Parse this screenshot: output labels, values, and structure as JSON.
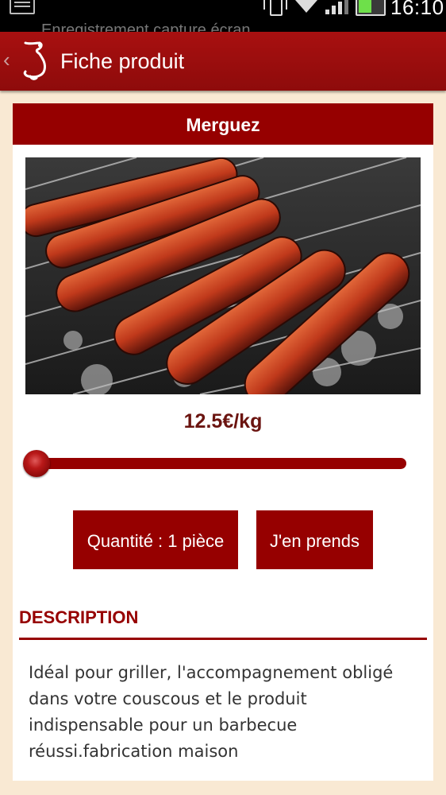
{
  "status_bar": {
    "time": "16:10",
    "notification_text": "Enregistrement capture écran",
    "icons": [
      "notification-icon",
      "vibrate-icon",
      "wifi-icon",
      "signal-icon",
      "battery-icon"
    ],
    "battery_color": "#6ee04a"
  },
  "action_bar": {
    "back_icon": "chevron-left-icon",
    "title": "Fiche produit",
    "background": "#a81010"
  },
  "product": {
    "name": "Merguez",
    "price": "12.5€/kg",
    "image": "merguez sausages on grill",
    "quantity_slider_level": 0
  },
  "buttons": {
    "quantity": "Quantité : 1 pièce",
    "take": "J'en prends"
  },
  "description": {
    "title": "DESCRIPTION",
    "text": "Idéal pour griller, l'accompagnement obligé dans votre couscous et le produit indispensable pour un barbecue réussi.fabrication maison"
  },
  "colors": {
    "primary": "#960000",
    "background": "#f9e9d3",
    "price_text": "#6b1410"
  }
}
